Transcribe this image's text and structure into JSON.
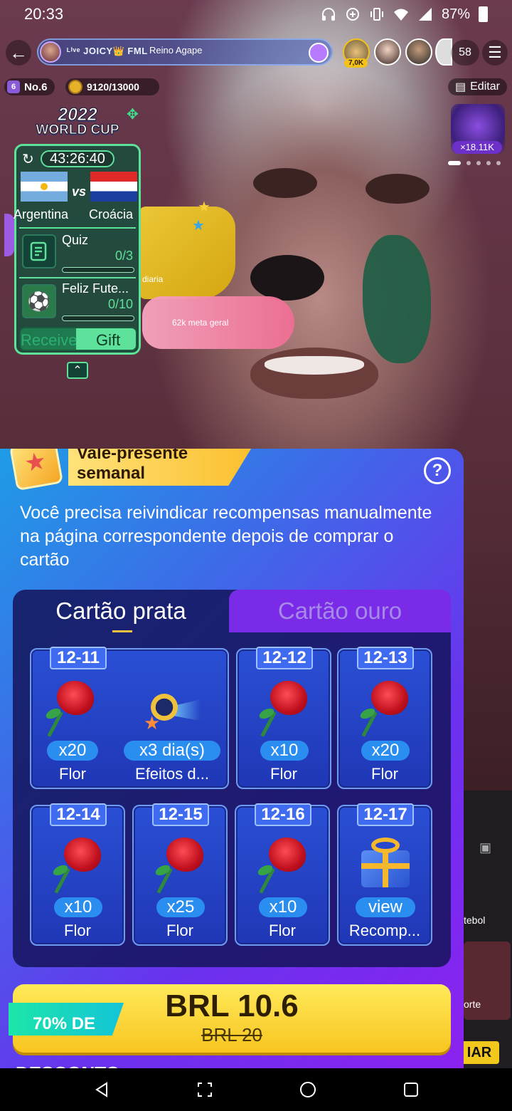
{
  "status_bar": {
    "time": "20:33",
    "battery": "87%"
  },
  "top_bar": {
    "host_name": "ᴸⁱᵛᵉ JOICY👑 FML",
    "host_subtitle": "Reino Agape",
    "viewer_badge": "7,0K",
    "viewer_count": "58"
  },
  "rank": {
    "label": "No.6",
    "level": "6"
  },
  "coins": {
    "progress": "9120/13000"
  },
  "edit": {
    "label": "Editar"
  },
  "world_cup": {
    "title_line1": "2022",
    "title_line2": "WORLD CUP",
    "timer": "43:26:40",
    "vs": "vs",
    "team_a": "Argentina",
    "team_b": "Croácia",
    "tasks": [
      {
        "title": "Quiz",
        "progress": "0/3",
        "fraction": 0
      },
      {
        "title": "Feliz Fute...",
        "progress": "0/10",
        "fraction": 0
      }
    ],
    "receive": "Receive",
    "gift": "Gift"
  },
  "goals": {
    "daily": "diaria",
    "total": "62k meta geral"
  },
  "chest": {
    "badge": "×18.11K"
  },
  "background_side": {
    "label1": "tebol",
    "label2": "orte",
    "button": "IAR"
  },
  "panel": {
    "title": "Vale-presente semanal",
    "help": "?",
    "description": "Você precisa reivindicar recompensas manualmente na página correspondente depois de comprar o cartão",
    "tabs": {
      "silver": "Cartão prata",
      "gold": "Cartão ouro"
    },
    "cards": [
      {
        "date": "12-11",
        "rewards": [
          {
            "qty": "x20",
            "name": "Flor",
            "icon": "rose-icon"
          },
          {
            "qty": "x3 dia(s)",
            "name": "Efeitos d...",
            "icon": "entry-effect-icon"
          }
        ]
      },
      {
        "date": "12-12",
        "rewards": [
          {
            "qty": "x10",
            "name": "Flor",
            "icon": "rose-icon"
          }
        ]
      },
      {
        "date": "12-13",
        "rewards": [
          {
            "qty": "x20",
            "name": "Flor",
            "icon": "rose-icon"
          }
        ]
      },
      {
        "date": "12-14",
        "rewards": [
          {
            "qty": "x10",
            "name": "Flor",
            "icon": "rose-icon"
          }
        ]
      },
      {
        "date": "12-15",
        "rewards": [
          {
            "qty": "x25",
            "name": "Flor",
            "icon": "rose-icon"
          }
        ]
      },
      {
        "date": "12-16",
        "rewards": [
          {
            "qty": "x10",
            "name": "Flor",
            "icon": "rose-icon"
          }
        ]
      },
      {
        "date": "12-17",
        "rewards": [
          {
            "qty": "view",
            "name": "Recomp...",
            "icon": "gift-box-icon"
          }
        ]
      }
    ],
    "discount": "70% DE",
    "price": "BRL 10.6",
    "old_price": "BRL 20",
    "cutoff_text": "DESCONTO"
  },
  "colors": {
    "panel_start": "#1f9ce6",
    "panel_end": "#8b22f0",
    "price_yellow": "#f7c51f",
    "discount_teal": "#1ce6a8",
    "world_cup_green": "#5ee19a"
  }
}
